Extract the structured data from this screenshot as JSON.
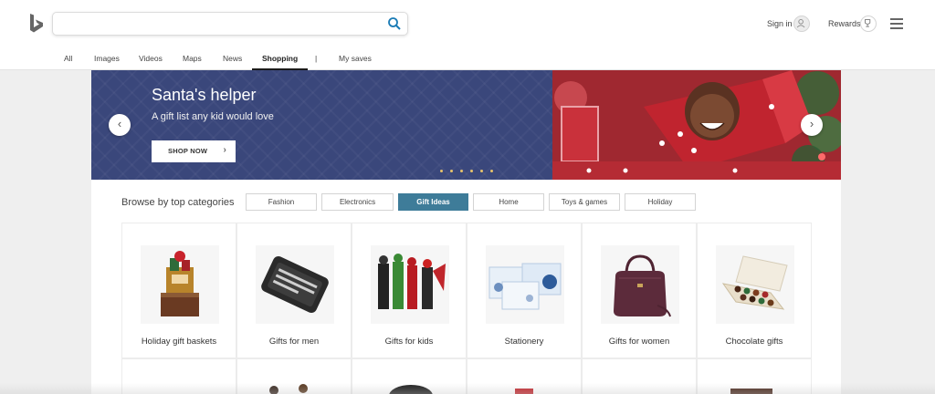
{
  "header": {
    "search": {
      "value": "",
      "placeholder": ""
    },
    "signin_label": "Sign in",
    "rewards_label": "Rewards"
  },
  "nav": {
    "items": [
      {
        "label": "All"
      },
      {
        "label": "Images"
      },
      {
        "label": "Videos"
      },
      {
        "label": "Maps"
      },
      {
        "label": "News"
      },
      {
        "label": "Shopping",
        "active": true
      },
      {
        "label": "|"
      },
      {
        "label": "My saves"
      }
    ]
  },
  "hero": {
    "title": "Santa's helper",
    "subtitle": "A gift list any kid would love",
    "cta": "SHOP NOW",
    "slide_count": 6,
    "accent_color": "#3a477b"
  },
  "browse": {
    "label": "Browse by top categories",
    "categories": [
      {
        "label": "Fashion"
      },
      {
        "label": "Electronics"
      },
      {
        "label": "Gift Ideas",
        "active": true
      },
      {
        "label": "Home"
      },
      {
        "label": "Toys & games"
      },
      {
        "label": "Holiday"
      }
    ],
    "active_color": "#3e7c99"
  },
  "tiles": [
    {
      "label": "Holiday gift baskets"
    },
    {
      "label": "Gifts for men"
    },
    {
      "label": "Gifts for kids"
    },
    {
      "label": "Stationery"
    },
    {
      "label": "Gifts for women"
    },
    {
      "label": "Chocolate gifts"
    }
  ]
}
